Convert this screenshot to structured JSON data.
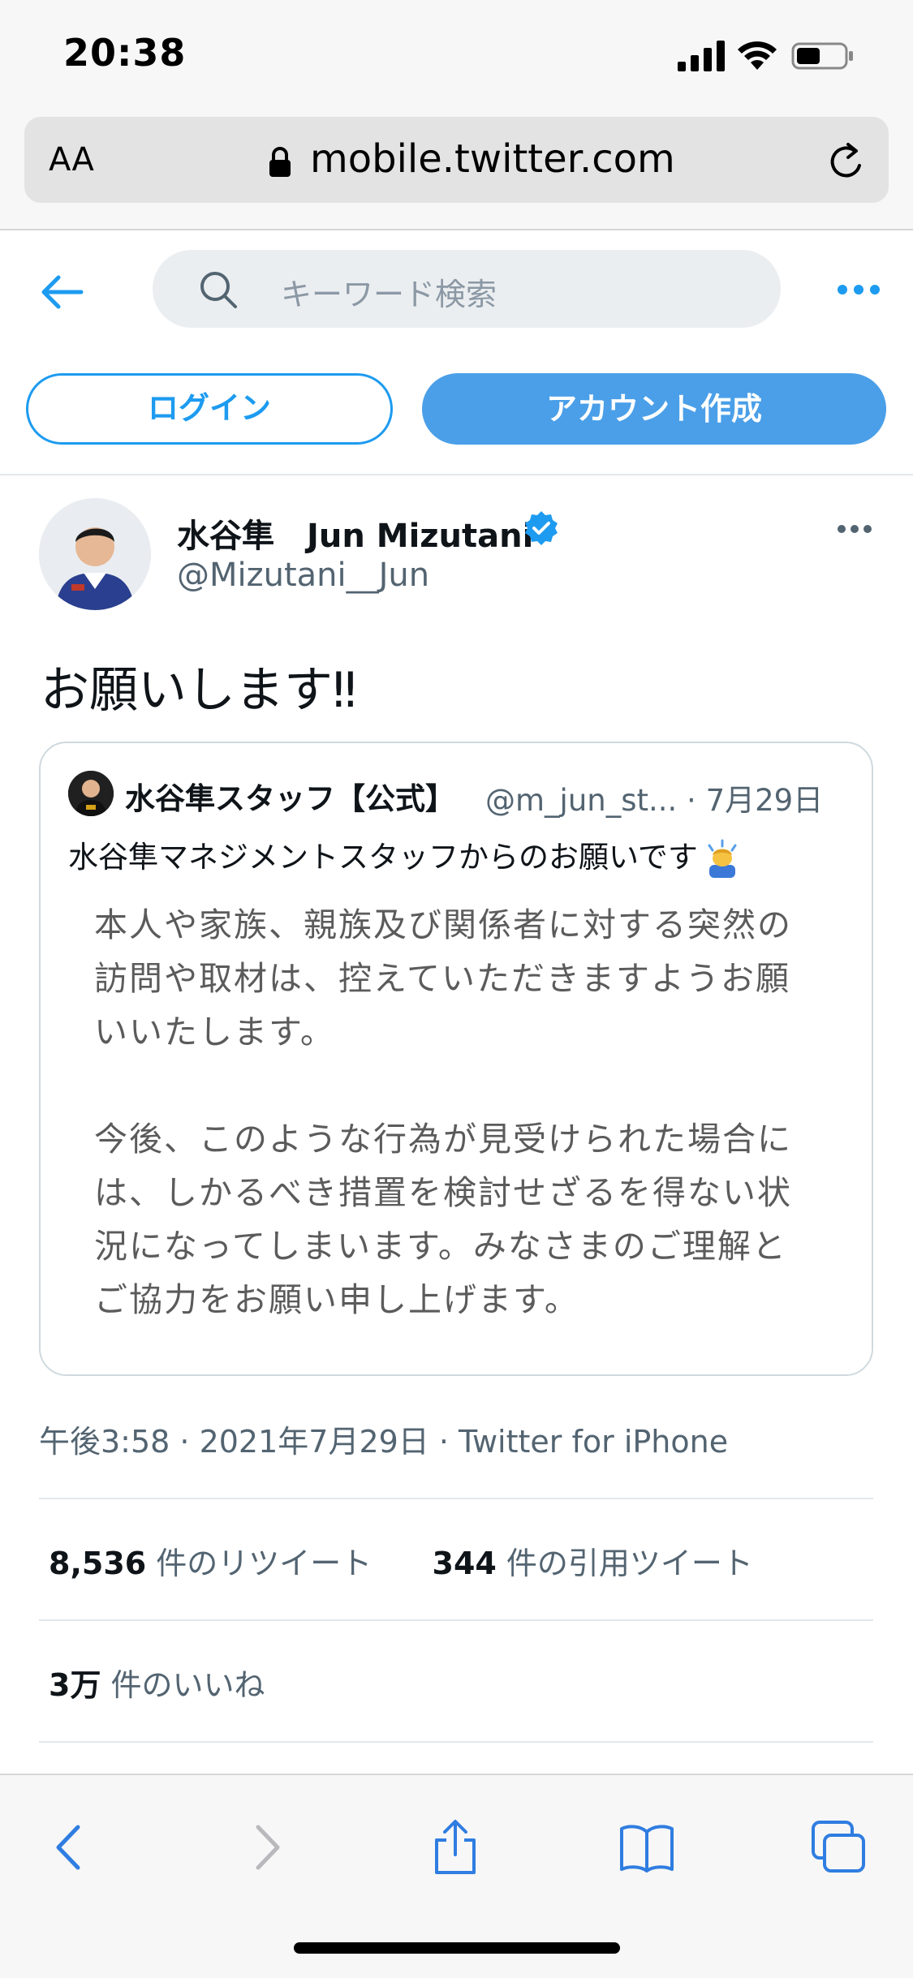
{
  "status_bar": {
    "time": "20:38"
  },
  "browser": {
    "text_size_label": "AA",
    "url": "mobile.twitter.com"
  },
  "twitter_header": {
    "search_placeholder": "キーワード検索",
    "login_label": "ログイン",
    "signup_label": "アカウント作成"
  },
  "tweet": {
    "author_name": "水谷隼　Jun Mizutani",
    "author_handle": "@Mizutani__Jun",
    "verified": true,
    "text": "お願いします‼︎",
    "quoted": {
      "author_name": "水谷隼スタッフ【公式】",
      "author_handle_date": "@m_jun_st... · 7月29日",
      "text": "水谷隼マネジメントスタッフからのお願いです",
      "image_lines": [
        "本人や家族、親族及び関係者に対する突然の",
        "訪問や取材は、控えていただきますようお願",
        "いいたします。",
        "",
        "今後、このような行為が見受けられた場合に",
        "は、しかるべき措置を検討せざるを得ない状",
        "況になってしまいます。みなさまのご理解と",
        "ご協力をお願い申し上げます。"
      ]
    },
    "meta": "午後3:58 · 2021年7月29日 · Twitter for iPhone",
    "retweets_count": "8,536",
    "retweets_label": "件のリツイート",
    "quotes_count": "344",
    "quotes_label": "件の引用ツイート",
    "likes_count": "3万",
    "likes_label": "件のいいね"
  },
  "colors": {
    "twitter_blue": "#1d9bf0",
    "signup_blue": "#4a9fe8",
    "safari_blue": "#2f7de1",
    "muted_text": "#536471"
  },
  "icons": {
    "back": "arrow-left-icon",
    "search": "search-icon",
    "more": "more-horizontal-icon",
    "verified": "verified-badge-icon",
    "lock": "lock-icon",
    "reload": "reload-icon",
    "toolbar": [
      "chevron-left-icon",
      "chevron-right-icon",
      "share-icon",
      "bookmarks-icon",
      "tabs-icon"
    ]
  }
}
